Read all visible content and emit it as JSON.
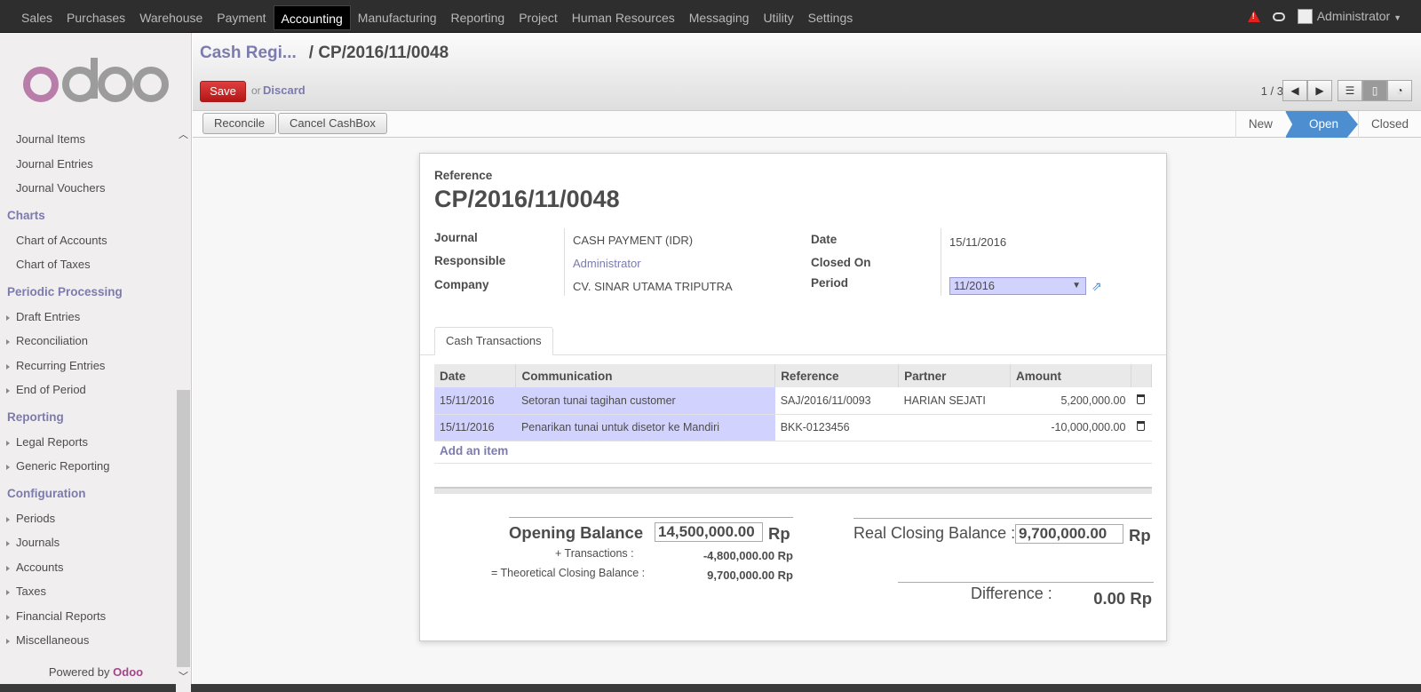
{
  "topbar": {
    "menu": [
      "Sales",
      "Purchases",
      "Warehouse",
      "Payment",
      "Accounting",
      "Manufacturing",
      "Reporting",
      "Project",
      "Human Resources",
      "Messaging",
      "Utility",
      "Settings"
    ],
    "active": "Accounting",
    "user": "Administrator"
  },
  "sidebar": {
    "logo_text": "odoo",
    "items": [
      {
        "type": "item",
        "label": "Journal Items"
      },
      {
        "type": "item",
        "label": "Journal Entries"
      },
      {
        "type": "item",
        "label": "Journal Vouchers"
      },
      {
        "type": "sec",
        "label": "Charts"
      },
      {
        "type": "item",
        "label": "Chart of Accounts"
      },
      {
        "type": "item",
        "label": "Chart of Taxes"
      },
      {
        "type": "sec",
        "label": "Periodic Processing"
      },
      {
        "type": "arrow",
        "label": "Draft Entries"
      },
      {
        "type": "arrow",
        "label": "Reconciliation"
      },
      {
        "type": "arrow",
        "label": "Recurring Entries"
      },
      {
        "type": "arrow",
        "label": "End of Period"
      },
      {
        "type": "sec",
        "label": "Reporting"
      },
      {
        "type": "arrow",
        "label": "Legal Reports"
      },
      {
        "type": "arrow",
        "label": "Generic Reporting"
      },
      {
        "type": "sec",
        "label": "Configuration"
      },
      {
        "type": "arrow",
        "label": "Periods"
      },
      {
        "type": "arrow",
        "label": "Journals"
      },
      {
        "type": "arrow",
        "label": "Accounts"
      },
      {
        "type": "arrow",
        "label": "Taxes"
      },
      {
        "type": "arrow",
        "label": "Financial Reports"
      },
      {
        "type": "arrow",
        "label": "Miscellaneous"
      }
    ],
    "powered_prefix": "Powered by",
    "powered_brand": "Odoo"
  },
  "header": {
    "breadcrumb_link": "Cash Regi...",
    "breadcrumb_sep": "/",
    "breadcrumb_current": "CP/2016/11/0048",
    "save": "Save",
    "or": "or",
    "discard": "Discard",
    "pager": "1 / 3"
  },
  "statusbar": {
    "reconcile": "Reconcile",
    "cancel_cashbox": "Cancel CashBox",
    "stages": [
      "New",
      "Open",
      "Closed"
    ],
    "current_stage": "Open"
  },
  "form": {
    "reference_label": "Reference",
    "reference": "CP/2016/11/0048",
    "journal_label": "Journal",
    "journal": "CASH PAYMENT (IDR)",
    "responsible_label": "Responsible",
    "responsible": "Administrator",
    "company_label": "Company",
    "company": "CV. SINAR UTAMA TRIPUTRA",
    "date_label": "Date",
    "date": "15/11/2016",
    "closed_on_label": "Closed On",
    "closed_on": "",
    "period_label": "Period",
    "period": "11/2016"
  },
  "tab": "Cash Transactions",
  "table": {
    "columns": [
      "Date",
      "Communication",
      "Reference",
      "Partner",
      "Amount"
    ],
    "rows": [
      {
        "date": "15/11/2016",
        "communication": "Setoran tunai tagihan customer",
        "reference": "SAJ/2016/11/0093",
        "partner": "HARIAN SEJATI",
        "amount": "5,200,000.00"
      },
      {
        "date": "15/11/2016",
        "communication": "Penarikan tunai untuk disetor ke Mandiri",
        "reference": "BKK-0123456",
        "partner": "",
        "amount": "-10,000,000.00"
      }
    ],
    "add_item": "Add an item"
  },
  "balances": {
    "opening_label": "Opening Balance",
    "opening_value": "14,500,000.00",
    "currency": "Rp",
    "transactions_label": "+ Transactions :",
    "transactions_value": "-4,800,000.00 Rp",
    "theoretical_label": "= Theoretical Closing Balance :",
    "theoretical_value": "9,700,000.00 Rp",
    "real_closing_label": "Real Closing Balance :",
    "real_closing_value": "9,700,000.00",
    "difference_label": "Difference :",
    "difference_value": "0.00 Rp"
  }
}
